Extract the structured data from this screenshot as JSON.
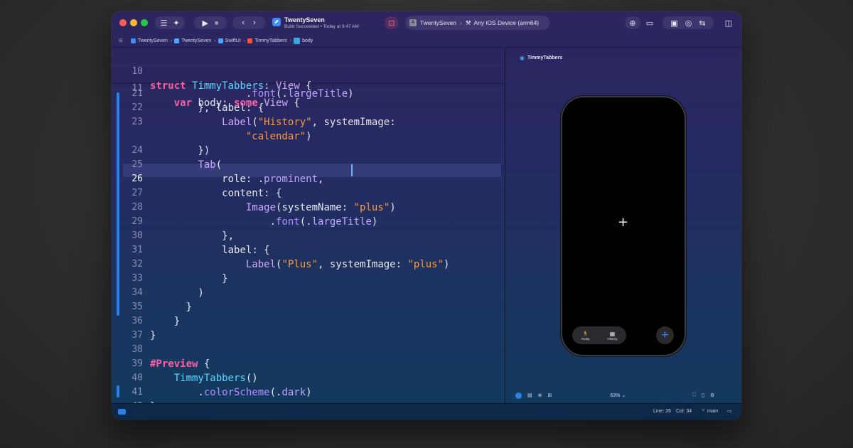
{
  "toolbar": {
    "app_title": "TwentySeven",
    "build_status": "Build Succeeded",
    "build_time": "Today at 9:47 AM",
    "scheme": "TwentySeven",
    "destination": "Any iOS Device (arm64)"
  },
  "breadcrumbs": [
    "TwentySeven",
    "TwentySeven",
    "SwiftUI",
    "TimmyTabbers",
    "body"
  ],
  "editor": {
    "sticky_lines": [
      {
        "num": "10",
        "code": "struct TimmyTabbers: View {"
      },
      {
        "num": "11",
        "code": "    var body: some View {"
      }
    ],
    "lines": [
      {
        "num": "21",
        "code": "                .font(.largeTitle)"
      },
      {
        "num": "22",
        "code": "        }, label: {"
      },
      {
        "num": "23",
        "code": "            Label(\"History\", systemImage:"
      },
      {
        "num": "",
        "code": "                \"calendar\")"
      },
      {
        "num": "24",
        "code": "        })"
      },
      {
        "num": "25",
        "code": "        Tab("
      },
      {
        "num": "26",
        "code": "            role: .prominent,"
      },
      {
        "num": "27",
        "code": "            content: {"
      },
      {
        "num": "28",
        "code": "                Image(systemName: \"plus\")"
      },
      {
        "num": "29",
        "code": "                    .font(.largeTitle)"
      },
      {
        "num": "30",
        "code": "            },"
      },
      {
        "num": "31",
        "code": "            label: {"
      },
      {
        "num": "32",
        "code": "                Label(\"Plus\", systemImage: \"plus\")"
      },
      {
        "num": "33",
        "code": "            }"
      },
      {
        "num": "34",
        "code": "        )"
      },
      {
        "num": "35",
        "code": "      }"
      },
      {
        "num": "36",
        "code": "    }"
      },
      {
        "num": "37",
        "code": "}"
      },
      {
        "num": "38",
        "code": ""
      },
      {
        "num": "39",
        "code": "#Preview {"
      },
      {
        "num": "40",
        "code": "    TimmyTabbers()"
      },
      {
        "num": "41",
        "code": "        .colorScheme(.dark)"
      },
      {
        "num": "42",
        "code": "}"
      }
    ],
    "current_line": "26"
  },
  "preview": {
    "title": "TimmyTabbers",
    "center_glyph": "+",
    "tabs": [
      {
        "icon": "figure-run-icon",
        "glyph": "🏃",
        "label": "Today"
      },
      {
        "icon": "calendar-icon",
        "glyph": "▦",
        "label": "History"
      }
    ],
    "fab_glyph": "+",
    "zoom": "63%"
  },
  "status": {
    "line": "Line: 26",
    "col": "Col: 34",
    "branch": "main"
  },
  "colors": {
    "keyword": "#fc5fa3",
    "string": "#fc9b3b",
    "type": "#d0a8ff",
    "accent": "#2f7fe8"
  }
}
